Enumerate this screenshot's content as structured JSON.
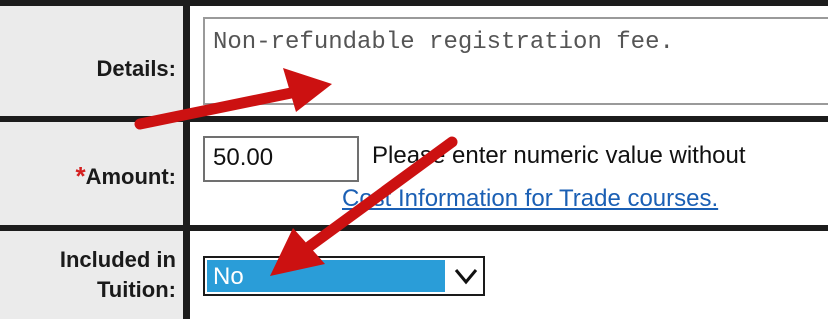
{
  "form": {
    "details_label": "Details:",
    "details_value": "Non-refundable registration fee.",
    "amount_required_mark": "*",
    "amount_label": "Amount:",
    "amount_value": "50.00",
    "amount_hint": "Please enter numeric value without",
    "cost_link": "Cost Information for Trade courses.",
    "included_label_line1": "Included in",
    "included_label_line2": "Tuition:",
    "included_value": "No"
  },
  "icons": {
    "select_chevron": "chevron-down-icon",
    "annotation": "red-arrow"
  },
  "colors": {
    "label_background": "#ebebeb",
    "grid_lines": "#1c1c1c",
    "required_mark": "#d42020",
    "link": "#1a5fb4",
    "select_highlight": "#2a9dd8",
    "annotation_arrow": "#cc1111"
  }
}
